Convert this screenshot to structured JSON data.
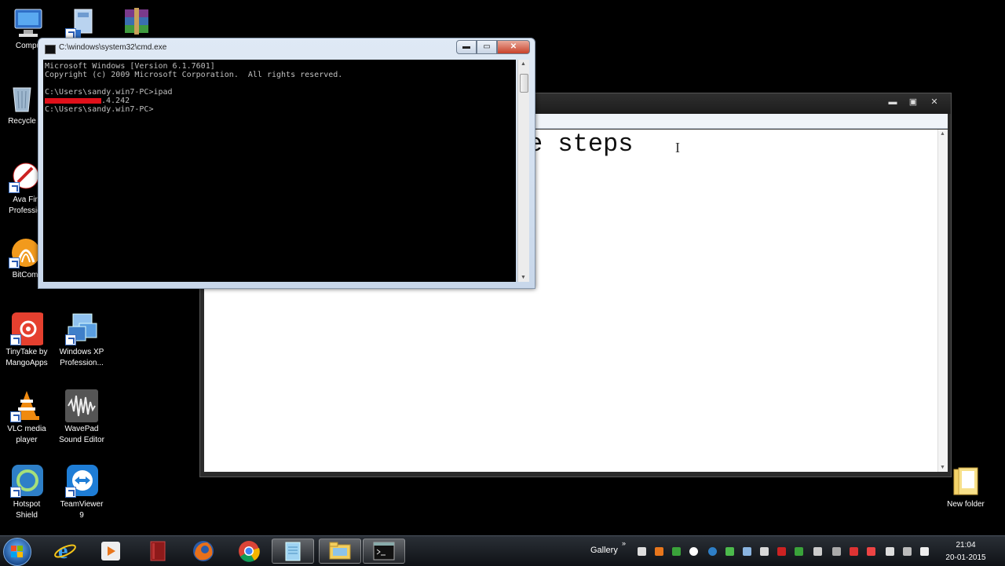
{
  "desktop": {
    "icons": [
      {
        "label": "Compu"
      },
      {
        "label": ""
      },
      {
        "label": ""
      },
      {
        "label": "Recycle"
      },
      {
        "label": "Ava Fir\nProfessio"
      },
      {
        "label": "BitCom"
      },
      {
        "label": "TinyTake by\nMangoApps"
      },
      {
        "label": "Windows XP\nProfession..."
      },
      {
        "label": "VLC media\nplayer"
      },
      {
        "label": "WavePad\nSound Editor"
      },
      {
        "label": "Hotspot\nShield"
      },
      {
        "label": "TeamViewer\n9"
      },
      {
        "label": "New folder"
      }
    ]
  },
  "notepad": {
    "visible_text": "e steps",
    "buttons": {
      "minimize": "▬",
      "maximize": "▣",
      "close": "✕"
    }
  },
  "cmd": {
    "title": "C:\\windows\\system32\\cmd.exe",
    "buttons": {
      "minimize": "▬",
      "maximize": "▭",
      "close": "✕"
    },
    "lines": [
      "Microsoft Windows [Version 6.1.7601]",
      "Copyright (c) 2009 Microsoft Corporation.  All rights reserved.",
      "",
      "C:\\Users\\sandy.win7-PC>ipad"
    ],
    "redacted_suffix": ".4.242",
    "prompt": "C:\\Users\\sandy.win7-PC>"
  },
  "taskbar": {
    "gallery_label": "Gallery",
    "chevron": "»",
    "clock": {
      "time": "21:04",
      "date": "20-01-2015"
    },
    "pinned": [
      "ie-icon",
      "media-player-icon",
      "book-icon",
      "firefox-icon",
      "chrome-icon",
      "notepad-icon",
      "explorer-icon",
      "cmd-icon"
    ]
  }
}
